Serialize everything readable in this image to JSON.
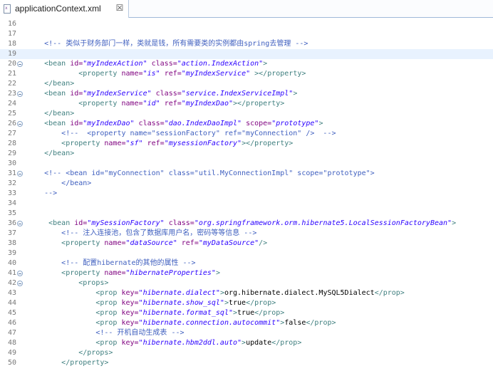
{
  "tab": {
    "title": "applicationContext.xml",
    "close_symbol": "☒",
    "file_icon": "x"
  },
  "editor": {
    "current_line": 19,
    "lines": [
      {
        "n": "16",
        "fold": false,
        "indent": "",
        "tokens": []
      },
      {
        "n": "17",
        "fold": false,
        "indent": "",
        "tokens": []
      },
      {
        "n": "18",
        "fold": false,
        "indent": "    ",
        "tokens": [
          {
            "t": "com",
            "v": "<!-- 类似于财务部门一样，类就是钱，所有需要类的实例都由spring去管理 -->"
          }
        ]
      },
      {
        "n": "19",
        "fold": false,
        "indent": "",
        "tokens": []
      },
      {
        "n": "20",
        "fold": true,
        "indent": "    ",
        "tokens": [
          {
            "t": "tag",
            "v": "<bean "
          },
          {
            "t": "attr",
            "v": "id="
          },
          {
            "t": "val",
            "v": "\"myIndexAction\""
          },
          {
            "t": "attr",
            "v": " class="
          },
          {
            "t": "val",
            "v": "\"action.IndexAction\""
          },
          {
            "t": "tag",
            "v": ">"
          }
        ]
      },
      {
        "n": "21",
        "fold": false,
        "indent": "            ",
        "tokens": [
          {
            "t": "tag",
            "v": "<property "
          },
          {
            "t": "attr",
            "v": "name="
          },
          {
            "t": "val",
            "v": "\"is\""
          },
          {
            "t": "attr",
            "v": " ref="
          },
          {
            "t": "val",
            "v": "\"myIndexService\""
          },
          {
            "t": "tag",
            "v": " ></property>"
          }
        ]
      },
      {
        "n": "22",
        "fold": false,
        "indent": "    ",
        "tokens": [
          {
            "t": "tag",
            "v": "</bean>"
          }
        ]
      },
      {
        "n": "23",
        "fold": true,
        "indent": "    ",
        "tokens": [
          {
            "t": "tag",
            "v": "<bean "
          },
          {
            "t": "attr",
            "v": "id="
          },
          {
            "t": "val",
            "v": "\"myIndexService\""
          },
          {
            "t": "attr",
            "v": " class="
          },
          {
            "t": "val",
            "v": "\"service.IndexServiceImpl\""
          },
          {
            "t": "tag",
            "v": ">"
          }
        ]
      },
      {
        "n": "24",
        "fold": false,
        "indent": "            ",
        "tokens": [
          {
            "t": "tag",
            "v": "<property "
          },
          {
            "t": "attr",
            "v": "name="
          },
          {
            "t": "val",
            "v": "\"id\""
          },
          {
            "t": "attr",
            "v": " ref="
          },
          {
            "t": "val",
            "v": "\"myIndexDao\""
          },
          {
            "t": "tag",
            "v": "></property>"
          }
        ]
      },
      {
        "n": "25",
        "fold": false,
        "indent": "    ",
        "tokens": [
          {
            "t": "tag",
            "v": "</bean>"
          }
        ]
      },
      {
        "n": "26",
        "fold": true,
        "indent": "    ",
        "tokens": [
          {
            "t": "tag",
            "v": "<bean "
          },
          {
            "t": "attr",
            "v": "id="
          },
          {
            "t": "val",
            "v": "\"myIndexDao\""
          },
          {
            "t": "attr",
            "v": " class="
          },
          {
            "t": "val",
            "v": "\"dao.IndexDaoImpl\""
          },
          {
            "t": "attr",
            "v": " scope="
          },
          {
            "t": "val",
            "v": "\"prototype\""
          },
          {
            "t": "tag",
            "v": ">"
          }
        ]
      },
      {
        "n": "27",
        "fold": false,
        "indent": "        ",
        "tokens": [
          {
            "t": "com",
            "v": "<!--  <property name=\"sessionFactory\" ref=\"myConnection\" />  -->"
          }
        ]
      },
      {
        "n": "28",
        "fold": false,
        "indent": "        ",
        "tokens": [
          {
            "t": "tag",
            "v": "<property "
          },
          {
            "t": "attr",
            "v": "name="
          },
          {
            "t": "val",
            "v": "\"sf\""
          },
          {
            "t": "attr",
            "v": " ref="
          },
          {
            "t": "val",
            "v": "\"mysessionFactory\""
          },
          {
            "t": "tag",
            "v": "></property>"
          }
        ]
      },
      {
        "n": "29",
        "fold": false,
        "indent": "    ",
        "tokens": [
          {
            "t": "tag",
            "v": "</bean>"
          }
        ]
      },
      {
        "n": "30",
        "fold": false,
        "indent": "",
        "tokens": []
      },
      {
        "n": "31",
        "fold": true,
        "indent": "    ",
        "tokens": [
          {
            "t": "com",
            "v": "<!-- <bean id=\"myConnection\" class=\"util.MyConnectionImpl\" scope=\"prototype\">"
          }
        ]
      },
      {
        "n": "32",
        "fold": false,
        "indent": "        ",
        "tokens": [
          {
            "t": "com",
            "v": "</bean>"
          }
        ]
      },
      {
        "n": "33",
        "fold": false,
        "indent": "    ",
        "tokens": [
          {
            "t": "com",
            "v": "-->"
          }
        ]
      },
      {
        "n": "34",
        "fold": false,
        "indent": "",
        "tokens": []
      },
      {
        "n": "35",
        "fold": false,
        "indent": "",
        "tokens": []
      },
      {
        "n": "36",
        "fold": true,
        "indent": "     ",
        "tokens": [
          {
            "t": "tag",
            "v": "<bean "
          },
          {
            "t": "attr",
            "v": "id="
          },
          {
            "t": "val",
            "v": "\"mySessionFactory\""
          },
          {
            "t": "attr",
            "v": " class="
          },
          {
            "t": "val",
            "v": "\"org.springframework.orm.hibernate5.LocalSessionFactoryBean\""
          },
          {
            "t": "tag",
            "v": ">"
          }
        ]
      },
      {
        "n": "37",
        "fold": false,
        "indent": "        ",
        "tokens": [
          {
            "t": "com",
            "v": "<!-- 注入连接池，包含了数据库用户名，密码等等信息 -->"
          }
        ]
      },
      {
        "n": "38",
        "fold": false,
        "indent": "        ",
        "tokens": [
          {
            "t": "tag",
            "v": "<property "
          },
          {
            "t": "attr",
            "v": "name="
          },
          {
            "t": "val",
            "v": "\"dataSource\""
          },
          {
            "t": "attr",
            "v": " ref="
          },
          {
            "t": "val",
            "v": "\"myDataSource\""
          },
          {
            "t": "tag",
            "v": "/>"
          }
        ]
      },
      {
        "n": "39",
        "fold": false,
        "indent": "",
        "tokens": []
      },
      {
        "n": "40",
        "fold": false,
        "indent": "        ",
        "tokens": [
          {
            "t": "com",
            "v": "<!-- 配置hibernate的其他的属性 -->"
          }
        ]
      },
      {
        "n": "41",
        "fold": true,
        "indent": "        ",
        "tokens": [
          {
            "t": "tag",
            "v": "<property "
          },
          {
            "t": "attr",
            "v": "name="
          },
          {
            "t": "val",
            "v": "\"hibernateProperties\""
          },
          {
            "t": "tag",
            "v": ">"
          }
        ]
      },
      {
        "n": "42",
        "fold": true,
        "indent": "            ",
        "tokens": [
          {
            "t": "tag",
            "v": "<props>"
          }
        ]
      },
      {
        "n": "43",
        "fold": false,
        "indent": "                ",
        "tokens": [
          {
            "t": "tag",
            "v": "<prop "
          },
          {
            "t": "attr",
            "v": "key="
          },
          {
            "t": "val",
            "v": "\"hibernate.dialect\""
          },
          {
            "t": "tag",
            "v": ">"
          },
          {
            "t": "text",
            "v": "org.hibernate.dialect.MySQL5Dialect"
          },
          {
            "t": "tag",
            "v": "</prop>"
          }
        ]
      },
      {
        "n": "44",
        "fold": false,
        "indent": "                ",
        "tokens": [
          {
            "t": "tag",
            "v": "<prop "
          },
          {
            "t": "attr",
            "v": "key="
          },
          {
            "t": "val",
            "v": "\"hibernate.show_sql\""
          },
          {
            "t": "tag",
            "v": ">"
          },
          {
            "t": "text",
            "v": "true"
          },
          {
            "t": "tag",
            "v": "</prop>"
          }
        ]
      },
      {
        "n": "45",
        "fold": false,
        "indent": "                ",
        "tokens": [
          {
            "t": "tag",
            "v": "<prop "
          },
          {
            "t": "attr",
            "v": "key="
          },
          {
            "t": "val",
            "v": "\"hibernate.format_sql\""
          },
          {
            "t": "tag",
            "v": ">"
          },
          {
            "t": "text",
            "v": "true"
          },
          {
            "t": "tag",
            "v": "</prop>"
          }
        ]
      },
      {
        "n": "46",
        "fold": false,
        "indent": "                ",
        "tokens": [
          {
            "t": "tag",
            "v": "<prop "
          },
          {
            "t": "attr",
            "v": "key="
          },
          {
            "t": "val",
            "v": "\"hibernate.connection.autocommit\""
          },
          {
            "t": "tag",
            "v": ">"
          },
          {
            "t": "text",
            "v": "false"
          },
          {
            "t": "tag",
            "v": "</prop>"
          }
        ]
      },
      {
        "n": "47",
        "fold": false,
        "indent": "                ",
        "tokens": [
          {
            "t": "com",
            "v": "<!-- 开机自动生成表 -->"
          }
        ]
      },
      {
        "n": "48",
        "fold": false,
        "indent": "                ",
        "tokens": [
          {
            "t": "tag",
            "v": "<prop "
          },
          {
            "t": "attr",
            "v": "key="
          },
          {
            "t": "val",
            "v": "\"hibernate.hbm2ddl.auto\""
          },
          {
            "t": "tag",
            "v": ">"
          },
          {
            "t": "text",
            "v": "update"
          },
          {
            "t": "tag",
            "v": "</prop>"
          }
        ]
      },
      {
        "n": "49",
        "fold": false,
        "indent": "            ",
        "tokens": [
          {
            "t": "tag",
            "v": "</props>"
          }
        ]
      },
      {
        "n": "50",
        "fold": false,
        "indent": "        ",
        "tokens": [
          {
            "t": "tag",
            "v": "</property>"
          }
        ]
      }
    ]
  }
}
